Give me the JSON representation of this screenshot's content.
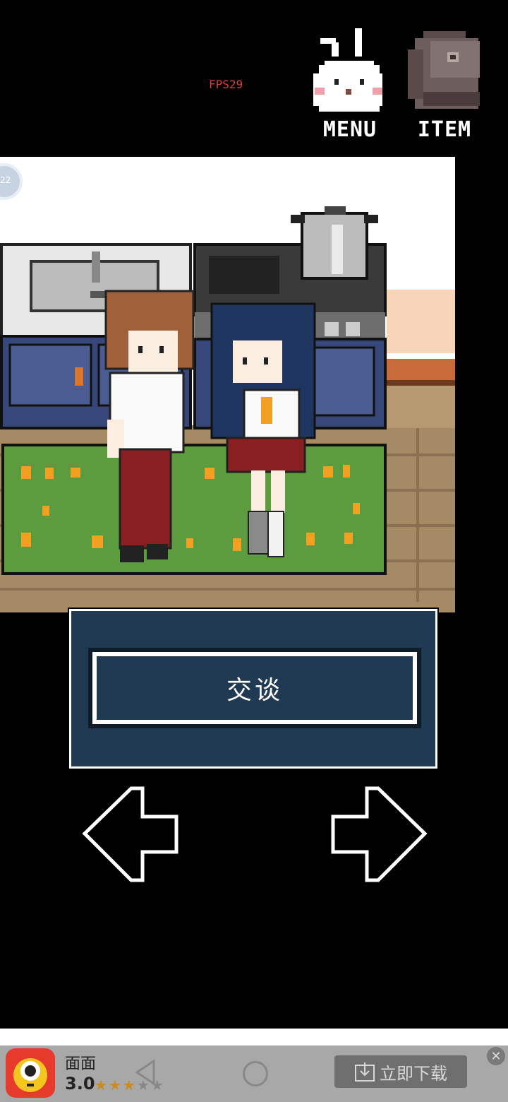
{
  "hud": {
    "fps": "FPS29",
    "menu_label": "MENU",
    "item_label": "ITEM",
    "menu_icon": "rabbit-icon",
    "item_icon": "backpack-icon"
  },
  "scene": {
    "badge_text": "22"
  },
  "dialog": {
    "talk_label": "交谈"
  },
  "navigation": {
    "left_icon": "left-arrow-icon",
    "right_icon": "right-arrow-icon"
  },
  "ad": {
    "app_name": "面面",
    "rating": "3.0",
    "rating_value": 3,
    "rating_max": 5,
    "cta_label": "立即下载",
    "close_icon": "close-icon"
  },
  "colors": {
    "dialog_bg": "#1f3a52",
    "fps": "#d8403a",
    "ad_bg": "#a8a8a8",
    "ad_icon_bg": "#e53a2c"
  }
}
